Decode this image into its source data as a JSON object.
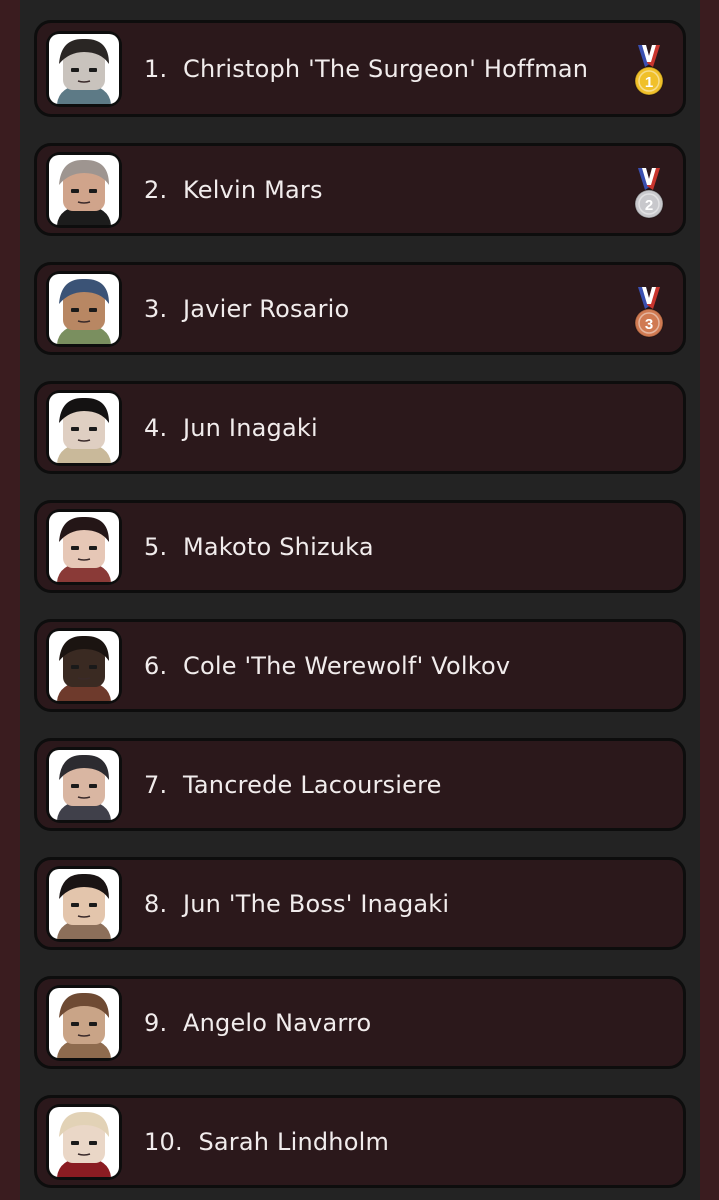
{
  "leaderboard": {
    "entries": [
      {
        "rank": "1.",
        "name": "Christoph 'The Surgeon' Hoffman",
        "medal": "gold-medal-icon",
        "avatar": {
          "skin": "#c9c3bd",
          "hair": "#2a2624",
          "accent": "#5d7a86"
        }
      },
      {
        "rank": "2.",
        "name": "Kelvin Mars",
        "medal": "silver-medal-icon",
        "avatar": {
          "skin": "#d0a48b",
          "hair": "#9e9590",
          "accent": "#1c1c1c"
        }
      },
      {
        "rank": "3.",
        "name": "Javier Rosario",
        "medal": "bronze-medal-icon",
        "avatar": {
          "skin": "#b88763",
          "hair": "#3b5376",
          "accent": "#7a8f5f"
        }
      },
      {
        "rank": "4.",
        "name": "Jun Inagaki",
        "medal": "",
        "avatar": {
          "skin": "#dfcfc2",
          "hair": "#141212",
          "accent": "#c9b99a"
        }
      },
      {
        "rank": "5.",
        "name": "Makoto Shizuka",
        "medal": "",
        "avatar": {
          "skin": "#e6c7b6",
          "hair": "#241617",
          "accent": "#8a3a37"
        }
      },
      {
        "rank": "6.",
        "name": "Cole 'The Werewolf' Volkov",
        "medal": "",
        "avatar": {
          "skin": "#3a2a22",
          "hair": "#1b1411",
          "accent": "#6e3a2c"
        }
      },
      {
        "rank": "7.",
        "name": "Tancrede Lacoursiere",
        "medal": "",
        "avatar": {
          "skin": "#d9b6a2",
          "hair": "#2c2b30",
          "accent": "#40404a"
        }
      },
      {
        "rank": "8.",
        "name": "Jun 'The Boss' Inagaki",
        "medal": "",
        "avatar": {
          "skin": "#e3c5ac",
          "hair": "#1a1414",
          "accent": "#8c6f5a"
        }
      },
      {
        "rank": "9.",
        "name": "Angelo Navarro",
        "medal": "",
        "avatar": {
          "skin": "#c9a487",
          "hair": "#6e4a33",
          "accent": "#8e6b4e"
        }
      },
      {
        "rank": "10.",
        "name": "Sarah Lindholm",
        "medal": "",
        "avatar": {
          "skin": "#ead7c7",
          "hair": "#e2d2b6",
          "accent": "#8a1c22"
        }
      }
    ]
  },
  "medal_colors": {
    "gold": "#f0c02a",
    "silver": "#c8c8cc",
    "bronze": "#d07a52",
    "ribbon_blue": "#3a4fb0",
    "ribbon_red": "#c8352e"
  }
}
